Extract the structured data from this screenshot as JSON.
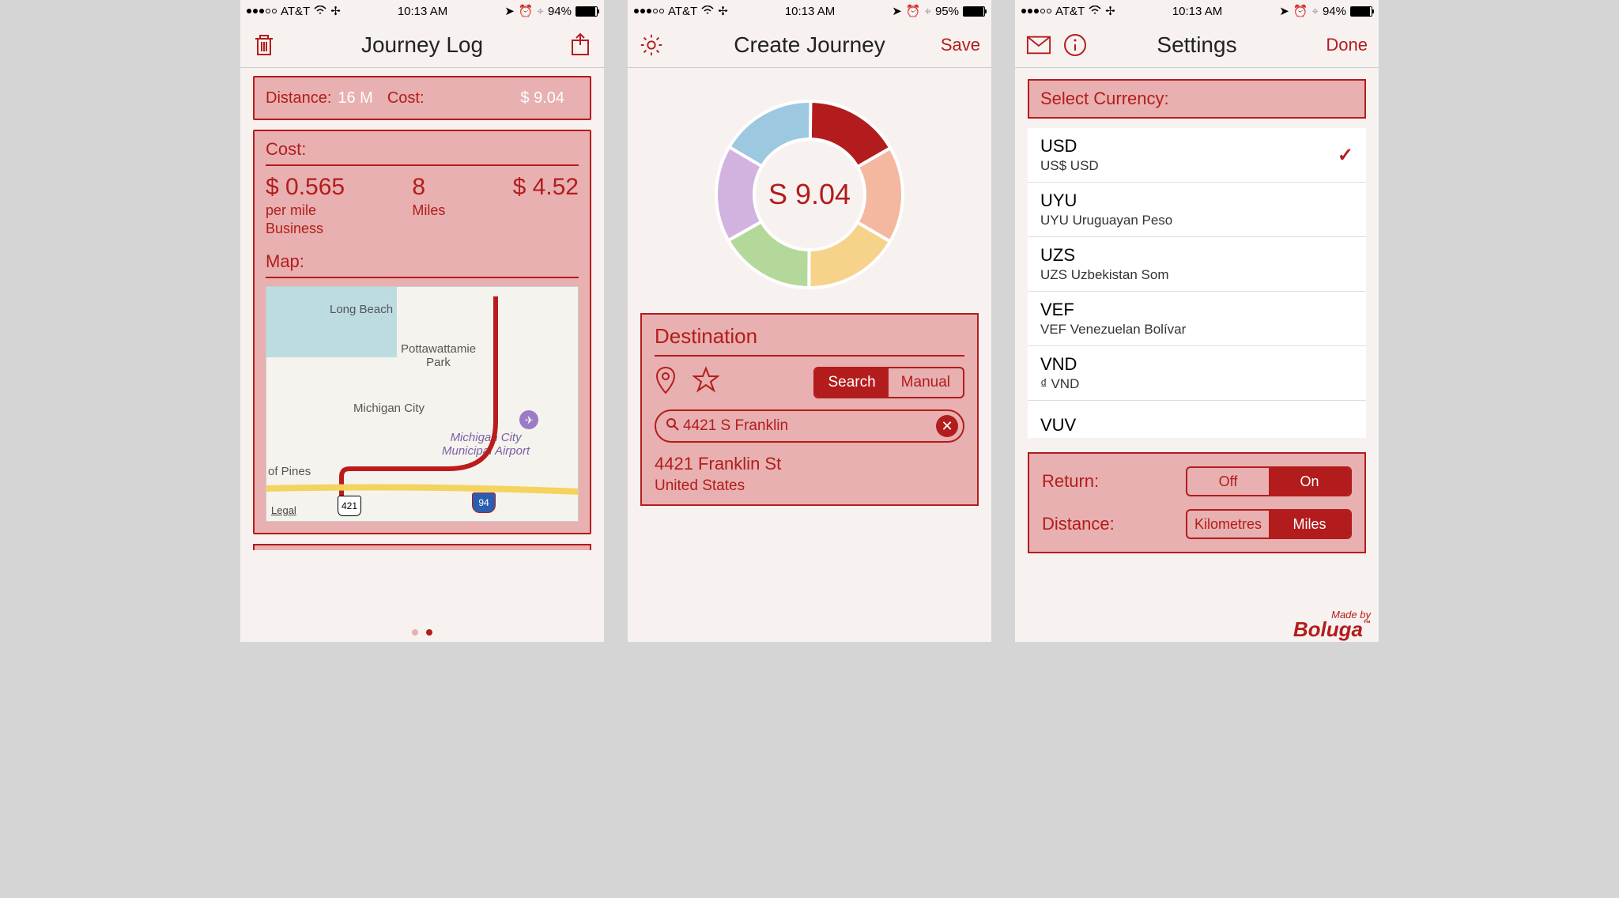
{
  "status": {
    "carrier": "AT&T",
    "time": "10:13 AM",
    "battery1": "94%",
    "battery2": "95%",
    "battery3": "94%"
  },
  "screen1": {
    "title": "Journey Log",
    "summary": {
      "distance_label": "Distance:",
      "distance_value": "16 M",
      "cost_label": "Cost:",
      "cost_value": "$ 9.04"
    },
    "cost_panel": {
      "heading": "Cost:",
      "rate": "$ 0.565",
      "rate_sub1": "per mile",
      "rate_sub2": "Business",
      "miles": "8",
      "miles_sub": "Miles",
      "total": "$ 4.52"
    },
    "map_heading": "Map:",
    "map_labels": {
      "longbeach": "Long Beach",
      "pottawattamie": "Pottawattamie\nPark",
      "michigan_city": "Michigan City",
      "airport": "Michigan City\nMunicipal Airport",
      "pines": "of Pines",
      "hwy421": "421",
      "hwy94": "94"
    },
    "legal": "Legal"
  },
  "screen2": {
    "title": "Create Journey",
    "save": "Save",
    "amount": "S 9.04",
    "dest_heading": "Destination",
    "search_mode": "Search",
    "manual_mode": "Manual",
    "search_value": "4421 S Franklin",
    "result_line1": "4421 Franklin St",
    "result_line2": "United States"
  },
  "screen3": {
    "title": "Settings",
    "done": "Done",
    "select_currency": "Select Currency:",
    "currencies": [
      {
        "code": "USD",
        "sub": "US$  USD",
        "selected": true
      },
      {
        "code": "UYU",
        "sub": "UYU  Uruguayan Peso",
        "selected": false
      },
      {
        "code": "UZS",
        "sub": "UZS  Uzbekistan Som",
        "selected": false
      },
      {
        "code": "VEF",
        "sub": "VEF  Venezuelan Bolívar",
        "selected": false
      },
      {
        "code": "VND",
        "sub": "₫  VND",
        "selected": false
      },
      {
        "code": "VUV",
        "sub": "",
        "selected": false
      }
    ],
    "return_label": "Return:",
    "return_off": "Off",
    "return_on": "On",
    "distance_label": "Distance:",
    "distance_km": "Kilometres",
    "distance_mi": "Miles",
    "brand_made": "Made by",
    "brand_name": "Boluga"
  },
  "chart_data": {
    "type": "pie",
    "title": "",
    "center_label": "S 9.04",
    "series": [
      {
        "name": "slice1",
        "value": 16.7,
        "color": "#b31c1c"
      },
      {
        "name": "slice2",
        "value": 16.7,
        "color": "#f4b8a0"
      },
      {
        "name": "slice3",
        "value": 16.7,
        "color": "#f7d28a"
      },
      {
        "name": "slice4",
        "value": 16.7,
        "color": "#b4d89a"
      },
      {
        "name": "slice5",
        "value": 16.7,
        "color": "#d2b3e0"
      },
      {
        "name": "slice6",
        "value": 16.7,
        "color": "#9cc8e0"
      }
    ]
  }
}
